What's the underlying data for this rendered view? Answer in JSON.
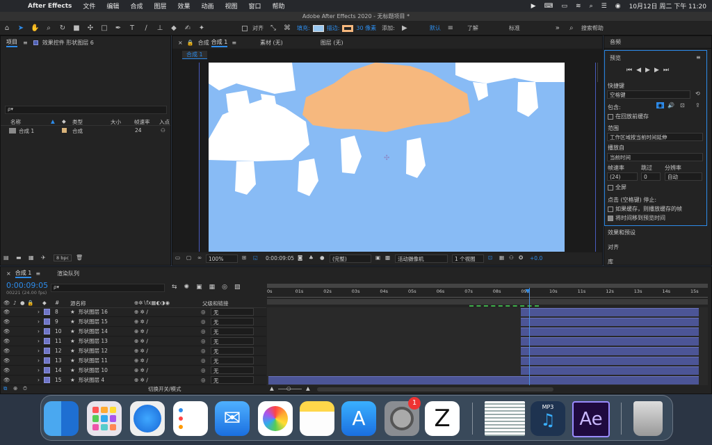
{
  "menubar": {
    "app": "After Effects",
    "items": [
      "文件",
      "编辑",
      "合成",
      "图层",
      "效果",
      "动画",
      "视图",
      "窗口",
      "帮助"
    ],
    "clock": "10月12日 周二 下午 11:20"
  },
  "window": {
    "title": "Adobe After Effects 2020 - 无标题项目 *"
  },
  "toolbar": {
    "snap_label": "对齐",
    "fill_label": "填充:",
    "stroke_label": "描边:",
    "stroke_width": "30 像素",
    "add_label": "添加:",
    "workspace_default": "默认",
    "workspace_learn": "了解",
    "workspace_standard": "标准",
    "search_placeholder": "搜索帮助"
  },
  "project": {
    "tab": "项目",
    "effects_tab": "效果控件 形状图层 6",
    "search_placeholder": "ρ▾",
    "cols": [
      "名称",
      "类型",
      "大小",
      "帧速率",
      "入点"
    ],
    "item_name": "合成 1",
    "item_type": "合成",
    "item_fps": "24",
    "bpc": "8 bpc"
  },
  "viewer": {
    "comp_tab_prefix": "合成",
    "comp_tab": "合成 1",
    "footage_tab": "素材 (无)",
    "layer_tab": "图层 (无)",
    "sub_tab": "合成 1",
    "zoom": "100%",
    "timecode": "0:00:09:05",
    "quality": "(完整)",
    "camera": "活动摄像机",
    "views": "1 个视图",
    "exposure": "+0.0"
  },
  "colors": {
    "sky": "#88bbf5",
    "sun": "#f6b87e",
    "cloud": "#ffffff",
    "fill_swatch": "#9ac8f0",
    "stroke_swatch": "#f6b87e"
  },
  "timeline": {
    "tab": "合成 1",
    "render_tab": "渲染队列",
    "timecode": "0:00:09:05",
    "fps": "00221 (24.00 fps)",
    "col_name": "源名称",
    "col_parent": "父级和链接",
    "toggle_label": "切换开关/模式",
    "ticks": [
      "0s",
      "01s",
      "02s",
      "03s",
      "04s",
      "05s",
      "06s",
      "07s",
      "08s",
      "09s",
      "10s",
      "11s",
      "12s",
      "13s",
      "14s",
      "15s"
    ],
    "layers": [
      {
        "num": "8",
        "name": "形状图层 16",
        "parent": "无"
      },
      {
        "num": "9",
        "name": "形状图层 15",
        "parent": "无"
      },
      {
        "num": "10",
        "name": "形状图层 14",
        "parent": "无"
      },
      {
        "num": "11",
        "name": "形状图层 13",
        "parent": "无"
      },
      {
        "num": "12",
        "name": "形状图层 12",
        "parent": "无"
      },
      {
        "num": "13",
        "name": "形状图层 11",
        "parent": "无"
      },
      {
        "num": "14",
        "name": "形状图层 10",
        "parent": "无"
      },
      {
        "num": "15",
        "name": "形状图层 4",
        "parent": "无"
      }
    ]
  },
  "right": {
    "audio_tab": "音频",
    "preview_tab": "预览",
    "shortcut_label": "快捷键",
    "shortcut_value": "空格键",
    "include_label": "包含:",
    "cache_label": "在回放前缓存",
    "range_label": "范围",
    "range_value": "工作区域按当前时间延伸",
    "play_from_label": "播放自",
    "play_from_value": "当前时间",
    "fps_label": "帧速率",
    "skip_label": "跳过",
    "res_label": "分辨率",
    "fps_value": "(24)",
    "skip_value": "0",
    "res_value": "自动",
    "fullscreen_label": "全屏",
    "stop_label": "点击 (空格键) 停止:",
    "stop_opt1": "如果缓存，则播放缓存的帧",
    "stop_opt2": "将时间移到预览时间",
    "effects_tab": "效果和预设",
    "align_tab": "对齐",
    "library_tab": "库"
  },
  "dock": {
    "badge": "1",
    "mp3": "MP3",
    "ae": "Ae",
    "icons": [
      "finder-icon",
      "launchpad-icon",
      "safari-icon",
      "reminders-icon",
      "mail-icon",
      "photos-icon",
      "notes-icon",
      "app-store-icon",
      "system-preferences-icon",
      "zbrush-icon",
      "screenshot-thumb-icon",
      "music-converter-icon",
      "after-effects-icon",
      "trash-icon"
    ]
  }
}
